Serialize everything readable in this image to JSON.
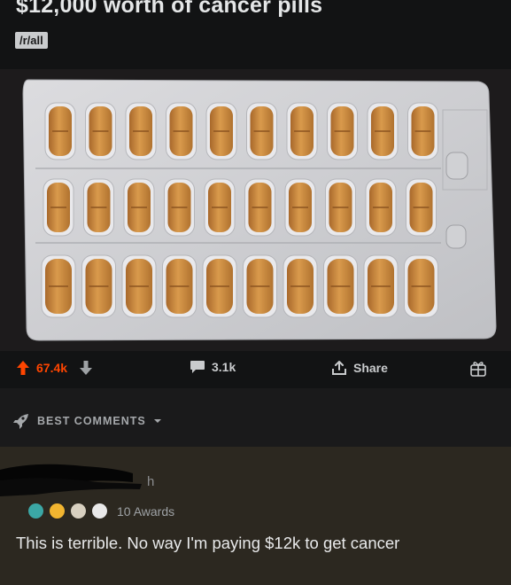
{
  "post": {
    "title": "$12,000 worth of cancer pills",
    "subreddit": "/r/all",
    "image": {
      "pill_rows": 3,
      "pills_per_row": 10
    }
  },
  "actions": {
    "upvotes": "67.4k",
    "comments": "3.1k",
    "share_label": "Share"
  },
  "sort": {
    "label": "BEST COMMENTS"
  },
  "comment": {
    "author_partial": "h",
    "awards_label": "10 Awards",
    "body": "This is terrible. No way I'm paying $12k to get cancer"
  },
  "colors": {
    "upvote": "#ff4500",
    "background": "#121314",
    "comment_bg": "#2c2820",
    "pill": "#c98a3e"
  }
}
